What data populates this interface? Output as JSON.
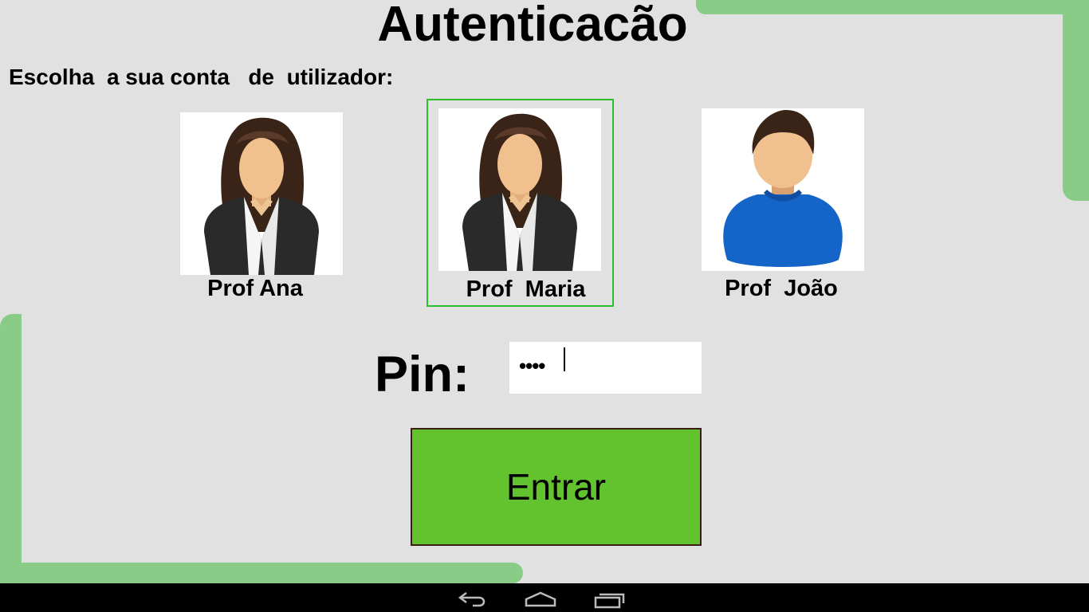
{
  "title": "Autenticacão",
  "subtitle": "Escolha  a sua conta   de  utilizador:",
  "accounts": [
    {
      "name": "Prof Ana",
      "avatar": "female-teacher-avatar",
      "selected": false
    },
    {
      "name": "Prof  Maria",
      "avatar": "female-teacher-avatar",
      "selected": true
    },
    {
      "name": "Prof  João",
      "avatar": "male-teacher-avatar",
      "selected": false
    }
  ],
  "pin": {
    "label": "Pin:",
    "value": "••••"
  },
  "enter_button": {
    "label": "Entrar"
  },
  "colors": {
    "background": "#e1e1e1",
    "decoration": "#88cc88",
    "selection_border": "#2bbf2b",
    "button": "#63c32f",
    "nav_bar": "#000000"
  },
  "nav_bar": {
    "buttons": [
      "back-icon",
      "home-icon",
      "recent-apps-icon"
    ]
  }
}
